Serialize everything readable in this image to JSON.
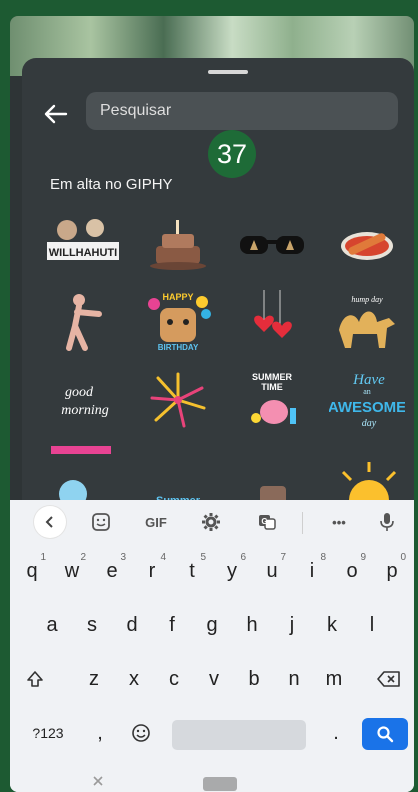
{
  "search": {
    "placeholder": "Pesquisar"
  },
  "badge": "37",
  "section_title": "Em alta no GIPHY",
  "stickers": [
    {
      "name": "sticker-willhahuti",
      "text": "WILLHAHUTI"
    },
    {
      "name": "sticker-cake",
      "text": ""
    },
    {
      "name": "sticker-sunglasses",
      "text": ""
    },
    {
      "name": "sticker-hotdog",
      "text": ""
    },
    {
      "name": "sticker-dancing-figure",
      "text": ""
    },
    {
      "name": "sticker-happy-birthday-cat",
      "text": "HAPPY BIRTHDAY"
    },
    {
      "name": "sticker-hearts",
      "text": ""
    },
    {
      "name": "sticker-camel",
      "text": "hump day"
    },
    {
      "name": "sticker-good-morning",
      "text": "good morning"
    },
    {
      "name": "sticker-fireworks",
      "text": ""
    },
    {
      "name": "sticker-summer-time",
      "text": "SUMMER TIME"
    },
    {
      "name": "sticker-have-an-awesome-day",
      "text": "Have an Awesome day"
    },
    {
      "name": "sticker-partial-1",
      "text": ""
    },
    {
      "name": "sticker-partial-2",
      "text": "Summer"
    },
    {
      "name": "sticker-partial-3",
      "text": ""
    },
    {
      "name": "sticker-sun",
      "text": ""
    }
  ],
  "toolbar": {
    "gif_label": "GIF",
    "more_label": "•••"
  },
  "keyboard": {
    "row1": [
      {
        "k": "q",
        "s": "1"
      },
      {
        "k": "w",
        "s": "2"
      },
      {
        "k": "e",
        "s": "3"
      },
      {
        "k": "r",
        "s": "4"
      },
      {
        "k": "t",
        "s": "5"
      },
      {
        "k": "y",
        "s": "6"
      },
      {
        "k": "u",
        "s": "7"
      },
      {
        "k": "i",
        "s": "8"
      },
      {
        "k": "o",
        "s": "9"
      },
      {
        "k": "p",
        "s": "0"
      }
    ],
    "row2": [
      "a",
      "s",
      "d",
      "f",
      "g",
      "h",
      "j",
      "k",
      "l"
    ],
    "row3": [
      "z",
      "x",
      "c",
      "v",
      "b",
      "n",
      "m"
    ],
    "symbols_label": "?123",
    "comma": ",",
    "period": "."
  },
  "colors": {
    "accent": "#1a73e8",
    "badge": "#1e6b37",
    "frame": "#1d5a32"
  }
}
